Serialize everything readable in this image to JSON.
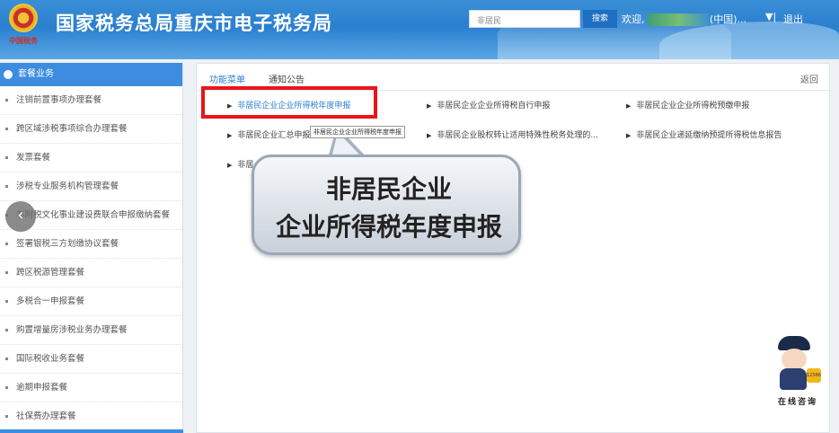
{
  "header": {
    "site_title": "国家税务总局重庆市电子税务局",
    "emblem_text": "中国税务",
    "search_value": "非居民",
    "search_button": "搜索",
    "welcome_prefix": "欢迎,",
    "user_suffix": "(中国)...",
    "dropdown": "▼|",
    "logout": "退出"
  },
  "sidebar": {
    "title": "套餐业务",
    "items": [
      "注销前置事项办理套餐",
      "跨区域涉税事项综合办理套餐",
      "发票套餐",
      "涉税专业服务机构管理套餐",
      "非附税文化事业建设费联合申报缴纳套餐",
      "签署银税三方划缴协议套餐",
      "跨区税源管理套餐",
      "多税合一申报套餐",
      "购置增量房涉税业务办理套餐",
      "国际税收业务套餐",
      "逾期申报套餐",
      "社保费办理套餐"
    ],
    "back_arrow": "‹"
  },
  "main": {
    "tabs": [
      "功能菜单",
      "通知公告"
    ],
    "return": "返回",
    "links": {
      "r1c1": "非居民企业企业所得税年度申报",
      "r1c2": "非居民企业企业所得税自行申报",
      "r1c3": "非居民企业企业所得税预缴申报",
      "r2c1": "非居民企业汇总申报",
      "r2c2": "非居民企业股权转让适用特殊性税务处理的...",
      "r2c3": "非居民企业递延缴纳预提所得税信息报告",
      "r3c1": "非居"
    },
    "tooltip": "非居民企业企业所得税年度申报",
    "arrow_glyph": "▶"
  },
  "callout": {
    "line1": "非居民企业",
    "line2": "企业所得税年度申报"
  },
  "mascot": {
    "phone_label": "12366",
    "label": "在线咨询"
  },
  "colors": {
    "header_blue": "#2a7fcf",
    "highlight_red": "#e8151a",
    "link_blue": "#2a7fcf"
  }
}
